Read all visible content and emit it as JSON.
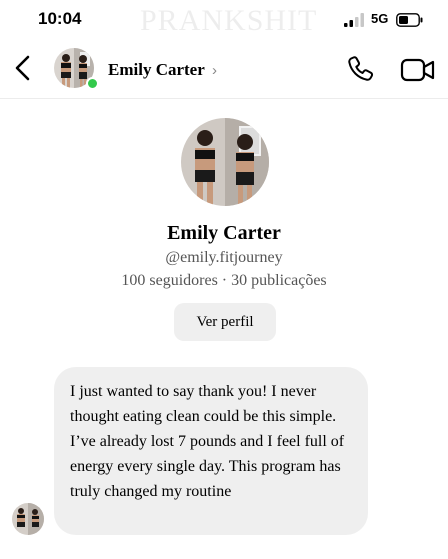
{
  "watermark": "PRANKSHIT",
  "status_bar": {
    "time": "10:04",
    "network": "5G"
  },
  "header": {
    "contact_name": "Emily Carter",
    "chevron": "›",
    "icons": [
      "back-chevron-icon",
      "phone-icon",
      "video-camera-icon"
    ],
    "online": true
  },
  "profile": {
    "name": "Emily Carter",
    "handle": "@emily.fitjourney",
    "stats": "100 seguidores · 30 publicações",
    "view_button": "Ver perfil"
  },
  "messages": [
    {
      "text": "I just wanted to say thank you! I never thought eating clean could be this simple. I’ve already lost 7 pounds and I feel full of energy every single day. This program has truly changed my routine"
    }
  ],
  "colors": {
    "online": "#33c94b",
    "bubble": "#efefef",
    "button": "#efefef"
  }
}
